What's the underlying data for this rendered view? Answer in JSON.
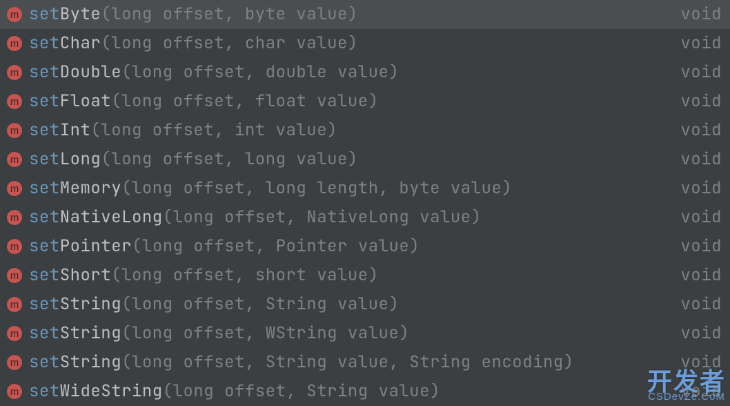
{
  "badge": "m",
  "prefix": "set",
  "items": [
    {
      "suffix": "Byte",
      "params": "(long offset, byte value)",
      "return": "void",
      "selected": true
    },
    {
      "suffix": "Char",
      "params": "(long offset, char value)",
      "return": "void",
      "selected": false
    },
    {
      "suffix": "Double",
      "params": "(long offset, double value)",
      "return": "void",
      "selected": false
    },
    {
      "suffix": "Float",
      "params": "(long offset, float value)",
      "return": "void",
      "selected": false
    },
    {
      "suffix": "Int",
      "params": "(long offset, int value)",
      "return": "void",
      "selected": false
    },
    {
      "suffix": "Long",
      "params": "(long offset, long value)",
      "return": "void",
      "selected": false
    },
    {
      "suffix": "Memory",
      "params": "(long offset, long length, byte value)",
      "return": "void",
      "selected": false
    },
    {
      "suffix": "NativeLong",
      "params": "(long offset, NativeLong value)",
      "return": "void",
      "selected": false
    },
    {
      "suffix": "Pointer",
      "params": "(long offset, Pointer value)",
      "return": "void",
      "selected": false
    },
    {
      "suffix": "Short",
      "params": "(long offset, short value)",
      "return": "void",
      "selected": false
    },
    {
      "suffix": "String",
      "params": "(long offset, String value)",
      "return": "void",
      "selected": false
    },
    {
      "suffix": "String",
      "params": "(long offset, WString value)",
      "return": "void",
      "selected": false
    },
    {
      "suffix": "String",
      "params": "(long offset, String value, String encoding)",
      "return": "void",
      "selected": false
    },
    {
      "suffix": "WideString",
      "params": "(long offset, String value)",
      "return": "void",
      "selected": false
    }
  ],
  "watermark": {
    "big": "开发者",
    "small": "CSDevZe.CoM"
  }
}
